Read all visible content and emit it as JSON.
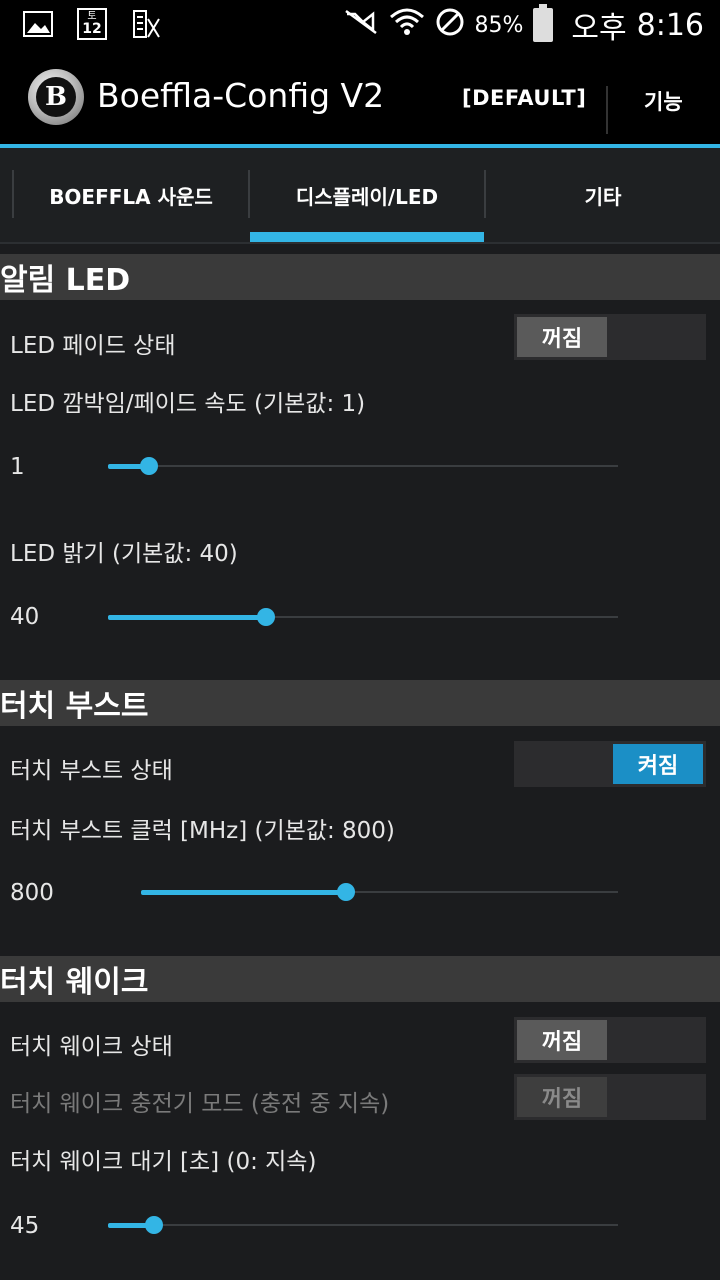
{
  "status_bar": {
    "icons": [
      "gallery-icon",
      "calendar-icon",
      "news-icon"
    ],
    "calendar_day_top": "토",
    "calendar_day_num": "12",
    "battery_pct": "85%",
    "time_period": "오후",
    "time": "8:16"
  },
  "action_bar": {
    "title": "Boeffla-Config V2",
    "logo_letter": "B",
    "profile": "[DEFAULT]",
    "menu": "기능"
  },
  "tabs": [
    {
      "label": "BOEFFLA 사운드",
      "selected": false
    },
    {
      "label": "디스플레이/LED",
      "selected": true
    },
    {
      "label": "기타",
      "selected": false
    }
  ],
  "sections": {
    "notification_led": {
      "title": "알림 LED",
      "fade_label": "LED 페이드 상태",
      "fade_toggle": "꺼짐",
      "speed_label": "LED 깜박임/페이드 속도 (기본값: 1)",
      "speed_value": "1",
      "speed_fraction": 0.08,
      "brightness_label": "LED 밝기 (기본값: 40)",
      "brightness_value": "40",
      "brightness_fraction": 0.31
    },
    "touch_boost": {
      "title": "터치 부스트",
      "state_label": "터치 부스트 상태",
      "state_toggle": "켜짐",
      "clock_label": "터치 부스트 클럭 [MHz] (기본값: 800)",
      "clock_value": "800",
      "clock_fraction": 0.43
    },
    "touch_wake": {
      "title": "터치 웨이크",
      "state_label": "터치 웨이크 상태",
      "state_toggle": "꺼짐",
      "charger_label": "터치 웨이크 충전기 모드 (충전 중 지속)",
      "charger_toggle": "꺼짐",
      "timeout_label": "터치 웨이크 대기 [초] (0: 지속)",
      "timeout_value": "45",
      "timeout_fraction": 0.09
    }
  },
  "colors": {
    "accent": "#33b5e5",
    "toggle_on": "#1b8fc6",
    "toggle_off": "#5a5a5a",
    "background": "#1b1c1e",
    "section_header": "#3a3a3a"
  }
}
